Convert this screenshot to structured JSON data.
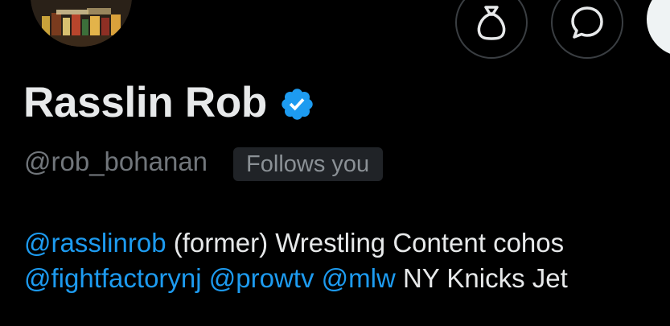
{
  "profile": {
    "display_name": "Rasslin Rob",
    "verified": true,
    "handle": "@rob_bohanan",
    "follows_you_label": "Follows you",
    "avatar_icon": "avatar-photo"
  },
  "actions": {
    "tip_icon": "money-bag-icon",
    "message_icon": "message-bubble-icon",
    "follow_button": "follow-button"
  },
  "bio": {
    "line1": {
      "mention": "@rasslinrob",
      "text": " (former) Wrestling Content cohos"
    },
    "line2": {
      "mention1": "@fightfactorynj",
      "sep1": " ",
      "mention2": "@prowtv",
      "sep2": " ",
      "mention3": "@mlw",
      "text": " NY Knicks Jet"
    }
  },
  "colors": {
    "background": "#000000",
    "name": "#e7e9ea",
    "secondary": "#71767b",
    "link": "#1d9bf0",
    "verified": "#1d9bf0",
    "badge_bg": "#202327"
  }
}
